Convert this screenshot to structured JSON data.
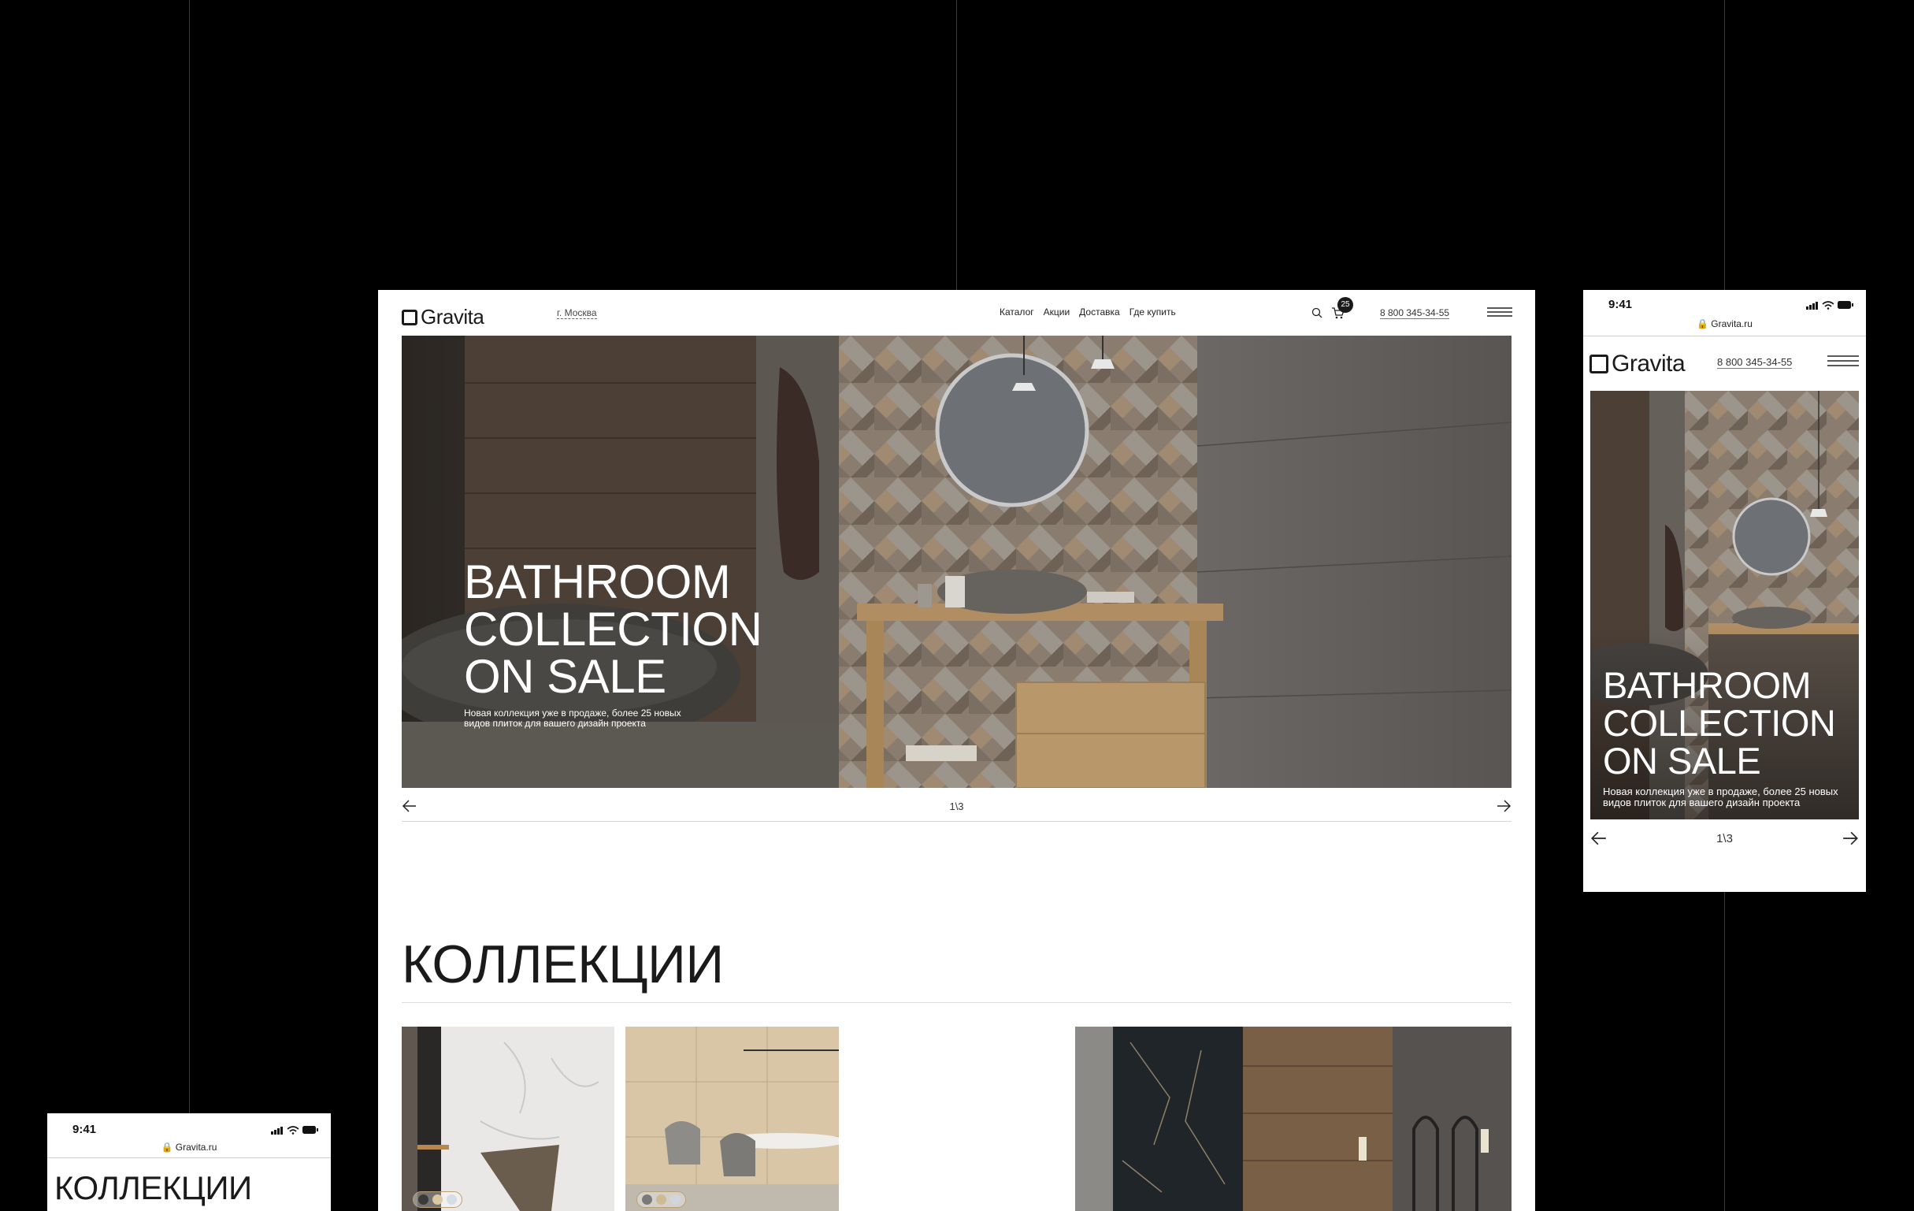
{
  "desktop": {
    "logo_text": "Gravita",
    "city": "г. Москва",
    "nav": [
      {
        "label": "Каталог"
      },
      {
        "label": "Акции"
      },
      {
        "label": "Доставка"
      },
      {
        "label": "Где купить"
      }
    ],
    "cart_count": "25",
    "phone": "8 800 345-34-55",
    "hero": {
      "title_lines": [
        "BATHROOM",
        "COLLECTION",
        "ON SALE"
      ],
      "subtitle_lines": [
        "Новая коллекция уже в продаже, более 25 новых",
        "видов плиток для вашего дизайн проекта"
      ],
      "counter": "1\\3"
    },
    "collections_title": "КОЛЛЕКЦИИ",
    "card_swatches": [
      [
        "#3a3a3a",
        "#d9c8a0",
        "#d7dde6"
      ],
      [
        "#7a7a7a",
        "#cdbb94",
        "#d0d6dc"
      ]
    ]
  },
  "mobile": {
    "time": "9:41",
    "url": "Gravita.ru",
    "logo_text": "Gravita",
    "phone": "8 800 345-34-55",
    "hero": {
      "title_lines": [
        "BATHROOM",
        "COLLECTION",
        "ON SALE"
      ],
      "subtitle_lines": [
        "Новая коллекция уже в продаже, более 25 новых",
        "видов плиток для вашего дизайн проекта"
      ],
      "counter": "1\\3"
    }
  },
  "mobile_collections": {
    "time": "9:41",
    "url": "Gravita.ru",
    "title": "КОЛЛЕКЦИИ"
  }
}
